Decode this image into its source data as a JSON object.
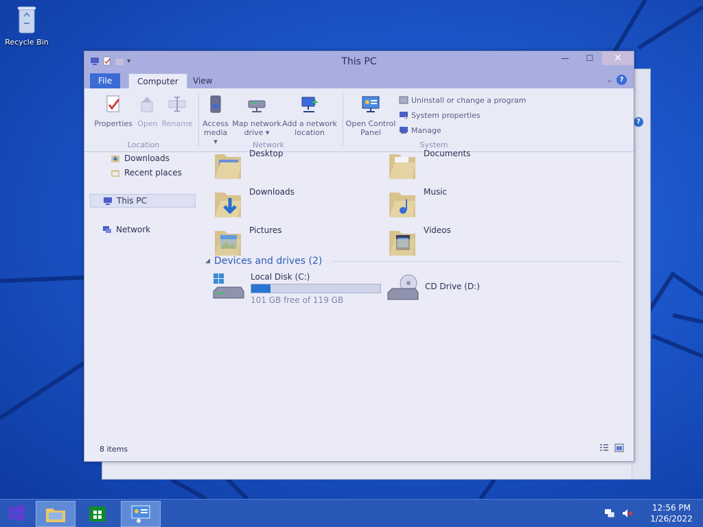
{
  "desktop": {
    "recycle_bin_label": "Recycle Bin"
  },
  "window": {
    "title": "This PC",
    "close_glyph": "✕",
    "maximize_glyph": "☐",
    "minimize_glyph": "—",
    "tabs": {
      "file": "File",
      "computer": "Computer",
      "view": "View"
    },
    "ribbon": {
      "location": {
        "group_label": "Location",
        "properties": "Properties",
        "open": "Open",
        "rename": "Rename"
      },
      "network": {
        "group_label": "Network",
        "access_media_line1": "Access",
        "access_media_line2": "media ▾",
        "map_drive_line1": "Map network",
        "map_drive_line2": "drive ▾",
        "add_location_line1": "Add a network",
        "add_location_line2": "location"
      },
      "system": {
        "group_label": "System",
        "open_cp_line1": "Open Control",
        "open_cp_line2": "Panel",
        "uninstall": "Uninstall or change a program",
        "system_properties": "System properties",
        "manage": "Manage"
      }
    },
    "nav": {
      "downloads": "Downloads",
      "recent_places": "Recent places",
      "this_pc": "This PC",
      "network": "Network"
    },
    "folders": {
      "desktop": "Desktop",
      "documents": "Documents",
      "downloads": "Downloads",
      "music": "Music",
      "pictures": "Pictures",
      "videos": "Videos"
    },
    "devices_header": "Devices and drives (2)",
    "drives": {
      "c_label": "Local Disk (C:)",
      "c_free": "101 GB free of 119 GB",
      "c_used_fraction": 0.15,
      "d_label": "CD Drive (D:)"
    },
    "status": "8 items"
  },
  "taskbar": {
    "time": "12:56 PM",
    "date": "1/26/2022"
  },
  "colors": {
    "accent": "#3b6bd6",
    "drive_bar": "#2a74d2"
  }
}
